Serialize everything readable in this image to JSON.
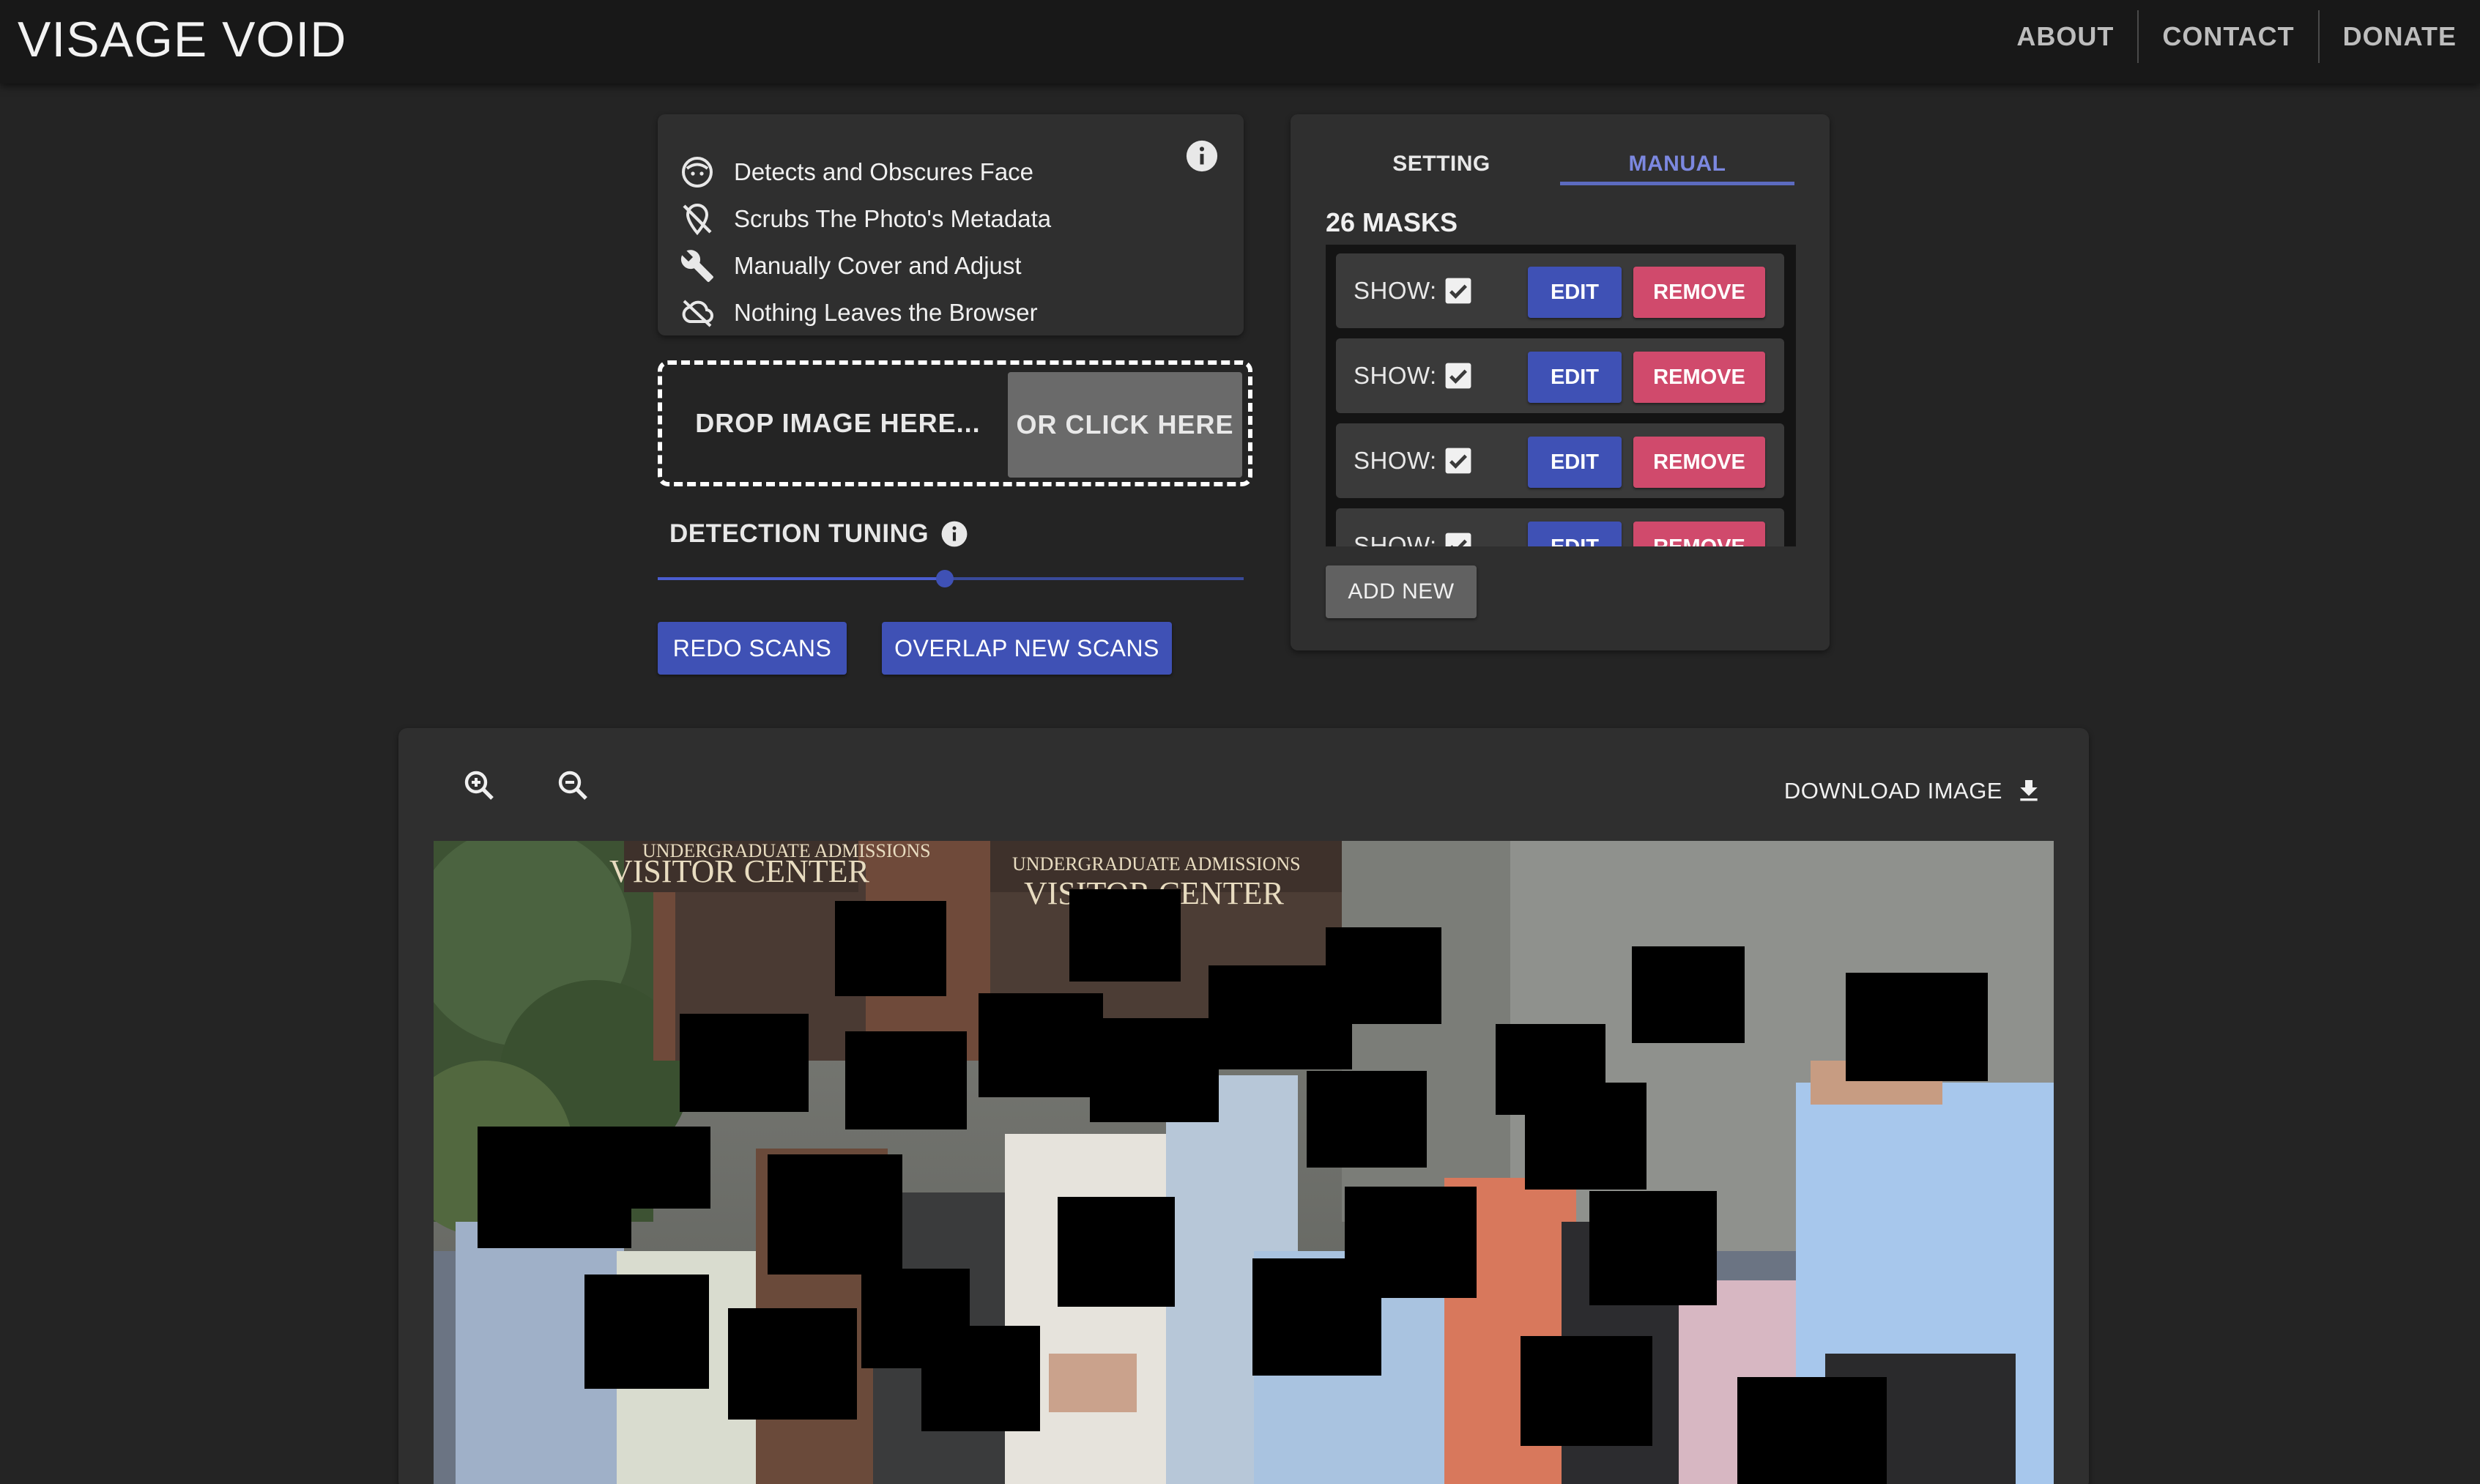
{
  "app": {
    "title": "VISAGE VOID"
  },
  "nav": {
    "items": [
      "ABOUT",
      "CONTACT",
      "DONATE"
    ]
  },
  "features": {
    "items": [
      {
        "icon": "face-icon",
        "text": "Detects and Obscures Face"
      },
      {
        "icon": "location-off-icon",
        "text": "Scrubs The Photo's Metadata"
      },
      {
        "icon": "wrench-icon",
        "text": "Manually Cover and Adjust"
      },
      {
        "icon": "cloud-off-icon",
        "text": "Nothing Leaves the Browser"
      }
    ]
  },
  "dropzone": {
    "drop_text": "DROP IMAGE HERE...",
    "click_text": "OR CLICK HERE"
  },
  "tuning": {
    "label": "DETECTION TUNING",
    "value": 0.49
  },
  "actions": {
    "redo": "REDO SCANS",
    "overlap": "OVERLAP NEW SCANS"
  },
  "masks_panel": {
    "tabs": [
      "SETTING",
      "MANUAL"
    ],
    "active_tab": "MANUAL",
    "count_label": "26 MASKS",
    "rows": [
      {
        "show_label": "SHOW:",
        "checked": true,
        "edit": "EDIT",
        "remove": "REMOVE"
      },
      {
        "show_label": "SHOW:",
        "checked": true,
        "edit": "EDIT",
        "remove": "REMOVE"
      },
      {
        "show_label": "SHOW:",
        "checked": true,
        "edit": "EDIT",
        "remove": "REMOVE"
      },
      {
        "show_label": "SHOW:",
        "checked": true,
        "edit": "EDIT",
        "remove": "REMOVE"
      }
    ],
    "add_new": "ADD NEW"
  },
  "viewer": {
    "download_label": "DOWNLOAD IMAGE",
    "photo_signs": [
      "UNDERGRADUATE ADMISSIONS",
      "VISITOR CENTER"
    ]
  },
  "colors": {
    "background": "#242424",
    "appbar": "#181818",
    "card": "#2f2f2f",
    "primary": "#3f51b5",
    "danger": "#d04a6c",
    "tab_active": "#7c88e0"
  }
}
